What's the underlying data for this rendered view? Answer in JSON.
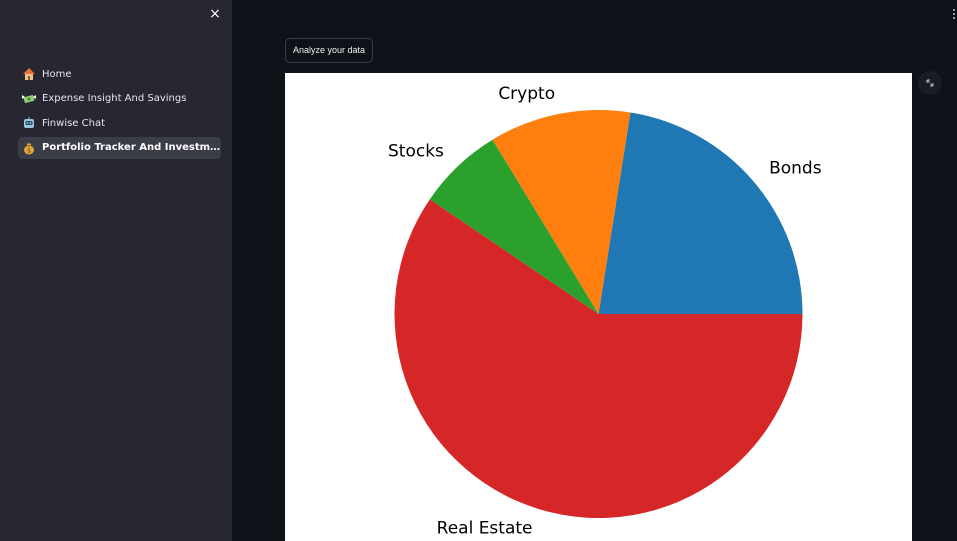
{
  "sidebar": {
    "close_label": "×",
    "items": [
      {
        "label": "Home",
        "icon": "house-icon",
        "active": false
      },
      {
        "label": "Expense Insight And Savings",
        "icon": "flying-money-icon",
        "active": false
      },
      {
        "label": "Finwise Chat",
        "icon": "robot-icon",
        "active": false
      },
      {
        "label": "Portfolio Tracker And Investment In...",
        "icon": "money-bag-icon",
        "active": true
      }
    ]
  },
  "main": {
    "analyze_button_label": "Analyze your data",
    "expand_icon": "fullscreen-expand-icon",
    "menu_icon": "vertical-ellipsis-icon"
  },
  "chart_data": {
    "type": "pie",
    "title": "",
    "slices": [
      {
        "label": "Bonds",
        "value": 22.5,
        "color": "#1f77b4"
      },
      {
        "label": "Crypto",
        "value": 11.2,
        "color": "#ff7f0e"
      },
      {
        "label": "Stocks",
        "value": 6.8,
        "color": "#2ca02c"
      },
      {
        "label": "Real Estate",
        "value": 59.5,
        "color": "#d62728"
      }
    ],
    "start_angle": 0,
    "direction": "counterclockwise",
    "legend": "none"
  },
  "colors": {
    "sidebar_bg": "#262730",
    "main_bg": "#0e1117",
    "active_item_bg": "#3a3c47"
  }
}
